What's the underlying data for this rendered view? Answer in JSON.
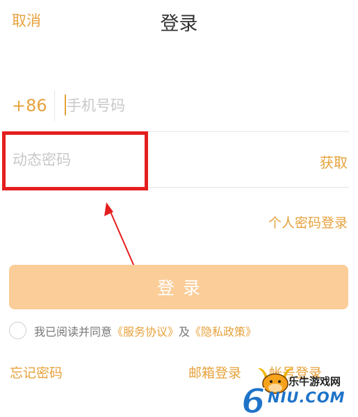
{
  "header": {
    "cancel_label": "取消",
    "title": "登录"
  },
  "phone": {
    "country_code": "+86",
    "placeholder": "手机号码"
  },
  "password": {
    "placeholder": "动态密码",
    "get_code_label": "获取"
  },
  "password_login_label": "个人密码登录",
  "login_button_label": "登录",
  "agreement": {
    "prefix": "我已阅读并同意",
    "service_link": "《服务协议》",
    "and": "及",
    "privacy_link": "《隐私政策》"
  },
  "footer": {
    "forgot_label": "忘记密码",
    "email_login_label": "邮箱登录",
    "account_login_label": "帐号登录"
  },
  "watermark": {
    "site_name": "乐牛游戏网",
    "domain": "NIU.COM",
    "digit": "6"
  },
  "colors": {
    "accent": "#e6a23c",
    "button_bg": "#fbcd98",
    "annotation_red": "#e41e1e"
  }
}
